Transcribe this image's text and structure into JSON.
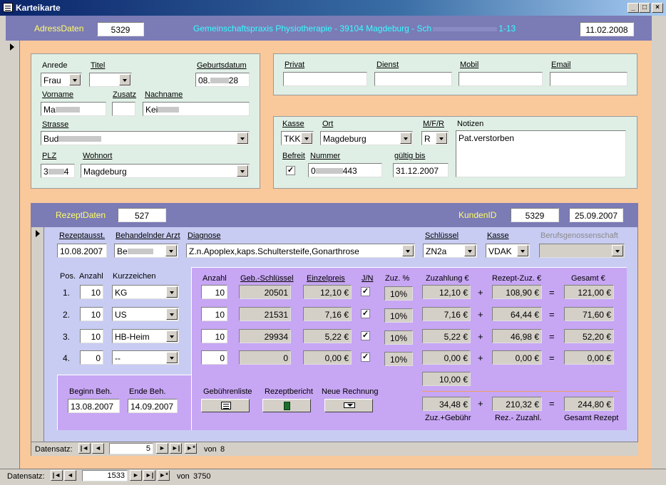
{
  "window": {
    "title": "Karteikarte"
  },
  "header": {
    "label": "AdressDaten",
    "id": "5329",
    "practice": "Gemeinschaftspraxis Physiotherapie - 39104 Magdeburg - Sch",
    "practice_suffix": "1-13",
    "date": "11.02.2008"
  },
  "address": {
    "anrede_label": "Anrede",
    "anrede": "Frau",
    "titel_label": "Titel",
    "titel": "",
    "geb_label": "Geburtsdatum",
    "geb": "08.",
    "geb_suffix": "28",
    "vorname_label": "Vorname",
    "vorname": "Ma",
    "zusatz_label": "Zusatz",
    "zusatz": "",
    "nachname_label": "Nachname",
    "nachname": "Kei",
    "strasse_label": "Strasse",
    "strasse": "Bud",
    "plz_label": "PLZ",
    "plz": "3",
    "plz_suffix": "4",
    "wohnort_label": "Wohnort",
    "wohnort": "Magdeburg"
  },
  "contact": {
    "privat_label": "Privat",
    "privat": "",
    "dienst_label": "Dienst",
    "dienst": "",
    "mobil_label": "Mobil",
    "mobil": "",
    "email_label": "Email",
    "email": ""
  },
  "insurance": {
    "kasse_label": "Kasse",
    "kasse": "TKK",
    "ort_label": "Ort",
    "ort": "Magdeburg",
    "mfr_label": "M/F/R",
    "mfr": "R",
    "notizen_label": "Notizen",
    "notizen": "Pat.verstorben",
    "befreit_label": "Befreit",
    "befreit_check": "✓",
    "nummer_label": "Nummer",
    "nummer": "0",
    "nummer_suffix": "443",
    "gueltig_label": "gültig bis",
    "gueltig": "31.12.2007"
  },
  "rezept": {
    "label": "RezeptDaten",
    "id": "527",
    "kunden_label": "KundenID",
    "kunden_id": "5329",
    "kunden_date": "25.09.2007",
    "ausst_label": "Rezeptausst.",
    "ausst": "10.08.2007",
    "arzt_label": "Behandelnder Arzt",
    "arzt": "Be",
    "diagnose_label": "Diagnose",
    "diagnose": "Z.n.Apoplex,kaps.Schultersteife,Gonarthrose",
    "schluessel_label": "Schlüssel",
    "schluessel": "ZN2a",
    "kasse_label": "Kasse",
    "kasse": "VDAK",
    "bg_label": "Berufsgenossenschaft",
    "bg": "",
    "pos_label": "Pos.",
    "anzahl_label": "Anzahl",
    "kurz_label": "Kurzzeichen",
    "beginn_label": "Beginn Beh.",
    "beginn": "13.08.2007",
    "ende_label": "Ende Beh.",
    "ende": "14.09.2007"
  },
  "positions": [
    {
      "pos": "1.",
      "anzahl": "10",
      "kurz": "KG"
    },
    {
      "pos": "2.",
      "anzahl": "10",
      "kurz": "US"
    },
    {
      "pos": "3.",
      "anzahl": "10",
      "kurz": "HB-Heim"
    },
    {
      "pos": "4.",
      "anzahl": "0",
      "kurz": "--"
    }
  ],
  "calc": {
    "headers": {
      "anzahl": "Anzahl",
      "geb": "Geb.-Schlüssel",
      "einzel": "Einzelpreis",
      "jn": "J/N",
      "zuz": "Zuz. %",
      "zuzahlung": "Zuzahlung €",
      "rezzuz": "Rezept-Zuz. €",
      "gesamt": "Gesamt €"
    },
    "rows": [
      {
        "anzahl": "10",
        "geb": "20501",
        "einzel": "12,10 €",
        "jn": "✓",
        "zuz": "10%",
        "zuzahlung": "12,10 €",
        "rezzuz": "108,90 €",
        "gesamt": "121,00 €"
      },
      {
        "anzahl": "10",
        "geb": "21531",
        "einzel": "7,16 €",
        "jn": "✓",
        "zuz": "10%",
        "zuzahlung": "7,16 €",
        "rezzuz": "64,44 €",
        "gesamt": "71,60 €"
      },
      {
        "anzahl": "10",
        "geb": "29934",
        "einzel": "5,22 €",
        "jn": "✓",
        "zuz": "10%",
        "zuzahlung": "5,22 €",
        "rezzuz": "46,98 €",
        "gesamt": "52,20 €"
      },
      {
        "anzahl": "0",
        "geb": "0",
        "einzel": "0,00 €",
        "jn": "✓",
        "zuz": "10%",
        "zuzahlung": "0,00 €",
        "rezzuz": "0,00 €",
        "gesamt": "0,00 €"
      }
    ],
    "plus": "+",
    "eq": "=",
    "gebuehr": "10,00 €",
    "total_zuz": "34,48 €",
    "total_rez": "210,32 €",
    "total_gesamt": "244,80 €",
    "total_zuz_label": "Zuz.+Gebühr",
    "total_rez_label": "Rez.- Zuzahl.",
    "total_gesamt_label": "Gesamt Rezept",
    "btn_gebuehren": "Gebührenliste",
    "btn_bericht": "Rezeptbericht",
    "btn_rechnung": "Neue Rechnung"
  },
  "subnav": {
    "label": "Datensatz:",
    "current": "5",
    "of_label": "von",
    "total": "8"
  },
  "mainnav": {
    "label": "Datensatz:",
    "current": "1533",
    "of_label": "von",
    "total": "3750"
  },
  "nav_glyphs": {
    "first": "|◄",
    "prev": "◄",
    "next": "►",
    "last": "►|",
    "new": "►*"
  },
  "window_buttons": {
    "min": "_",
    "max": "□",
    "close": "×"
  },
  "colors": {
    "header_bar": "#7b7bb6",
    "peach": "#f9c89b",
    "mint": "#dfefe5",
    "lavender": "#c7a6f4",
    "bluebg": "#c8ccf2",
    "yellow": "#ffff66",
    "cyan": "#33ffff"
  }
}
